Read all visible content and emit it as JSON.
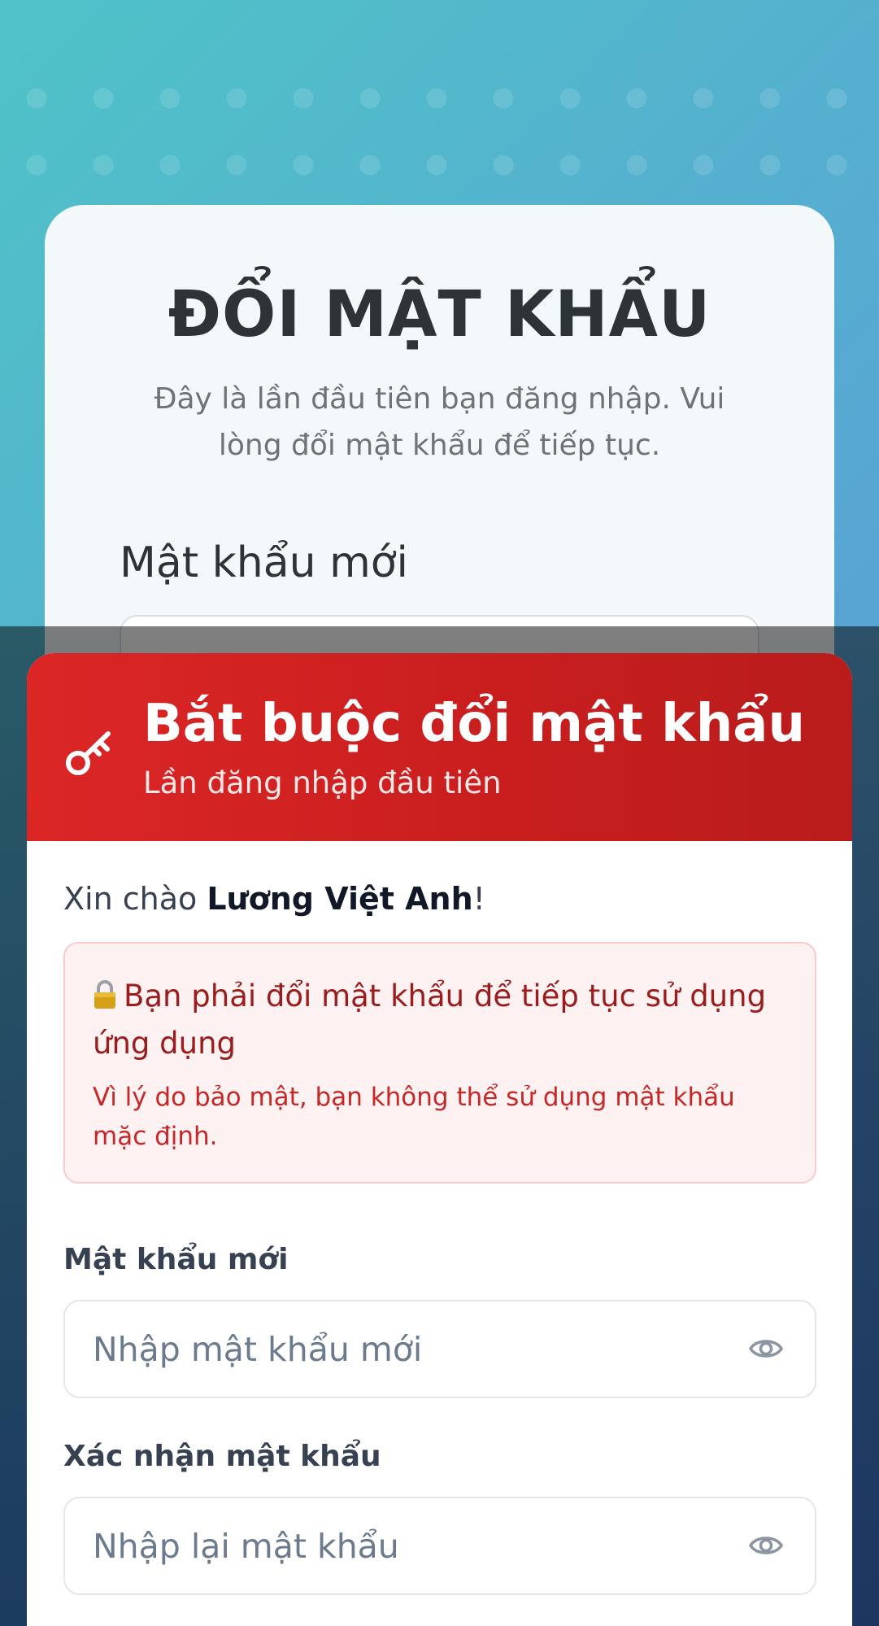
{
  "background_screen": {
    "title": "ĐỔI MẬT KHẨU",
    "subtitle": "Đây là lần đầu tiên bạn đăng nhập. Vui lòng đổi mật khẩu để tiếp tục.",
    "new_password_label": "Mật khẩu mới"
  },
  "modal": {
    "header": {
      "icon": "key-icon",
      "title": "Bắt buộc đổi mật khẩu",
      "subtitle": "Lần đăng nhập đầu tiên",
      "color": "#dc2626"
    },
    "greeting": {
      "prefix": "Xin chào ",
      "name": "Lương Việt Anh",
      "suffix": "!"
    },
    "alert": {
      "icon": "lock-icon",
      "title": "Bạn phải đổi mật khẩu để tiếp tục sử dụng ứng dụng",
      "description": "Vì lý do bảo mật, bạn không thể sử dụng mật khẩu mặc định."
    },
    "fields": {
      "new_password": {
        "label": "Mật khẩu mới",
        "placeholder": "Nhập mật khẩu mới",
        "value": "",
        "icon": "eye-icon"
      },
      "confirm_password": {
        "label": "Xác nhận mật khẩu",
        "placeholder": "Nhập lại mật khẩu",
        "value": "",
        "icon": "eye-icon"
      }
    }
  }
}
